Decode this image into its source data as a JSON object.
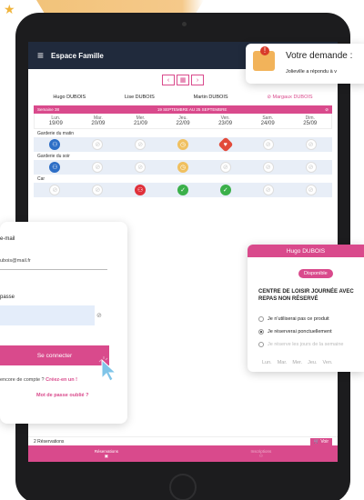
{
  "app": {
    "title": "Espace Famille"
  },
  "calendar": {
    "people": [
      "Hugo DUBOIS",
      "Lise DUBOIS",
      "Martin DUBOIS",
      "Margaux DUBOIS"
    ],
    "week_label": "Semaine 38",
    "range_label": "19 SEPTEMBRE AU 25 SEPTEMBRE",
    "days": [
      {
        "name": "Lun.",
        "date": "19/09"
      },
      {
        "name": "Mar.",
        "date": "20/09"
      },
      {
        "name": "Mer.",
        "date": "21/09"
      },
      {
        "name": "Jeu.",
        "date": "22/09"
      },
      {
        "name": "Ven.",
        "date": "23/09"
      },
      {
        "name": "Sam.",
        "date": "24/09"
      },
      {
        "name": "Dim.",
        "date": "25/09"
      }
    ],
    "sections": [
      {
        "label": "Garderie du matin",
        "cells": [
          "blue",
          "empty",
          "empty",
          "yellow",
          "heart",
          "empty",
          "empty"
        ]
      },
      {
        "label": "Garderie du soir",
        "cells": [
          "blue",
          "empty",
          "empty",
          "yellow",
          "empty",
          "empty",
          "empty"
        ]
      },
      {
        "label": "Car",
        "cells": [
          "empty",
          "empty",
          "red",
          "green",
          "green",
          "empty",
          "empty"
        ]
      }
    ]
  },
  "status": {
    "reservations": "2 Réservations",
    "voir": "Voir"
  },
  "bottom_nav": {
    "reservations": "Réservations",
    "inscriptions": "Inscriptions"
  },
  "login": {
    "email_label": "e-mail",
    "email_value": "ubois@mail.fr",
    "password_label": "passe",
    "connect_label": "Se connecter",
    "no_account": "encore de compte ?",
    "create_link": "Créez-en un !",
    "forgot": "Mot de passe oublié ?"
  },
  "notification": {
    "title": "Votre demande :",
    "subtitle": "Jolieville a répondu à v"
  },
  "activity": {
    "child": "Hugo DUBOIS",
    "badge": "Disponible",
    "title": "CENTRE DE LOISIR JOURNÉE AVEC REPAS NON RÉSERVÉ",
    "options": [
      "Je n'utiliserai pas ce produit",
      "Je réserverai ponctuellement",
      "Je réserve les jours de la semaine"
    ],
    "weekdays": [
      "Lun.",
      "Mar.",
      "Mer.",
      "Jeu.",
      "Ven."
    ]
  }
}
